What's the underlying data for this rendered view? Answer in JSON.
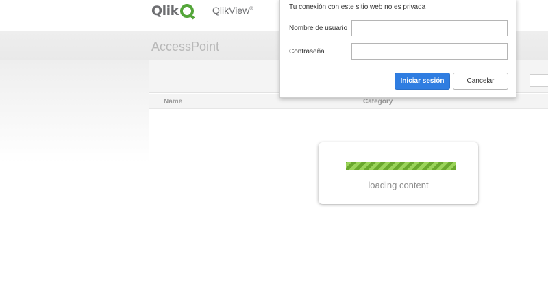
{
  "header": {
    "brand": "Qlik",
    "product": "QlikView",
    "product_mark": "®"
  },
  "page": {
    "title": "AccessPoint"
  },
  "table": {
    "columns": [
      "Name",
      "Category"
    ]
  },
  "loading": {
    "text": "loading content",
    "progress_percent": 100,
    "bar_color": "#7fc241"
  },
  "auth_dialog": {
    "message": "Tu conexión con este sitio web no es privada",
    "username_label": "Nombre de usuario",
    "username_value": "",
    "password_label": "Contraseña",
    "password_value": "",
    "login_button": "Iniciar sesión",
    "cancel_button": "Cancelar",
    "primary_color": "#2f7de1"
  },
  "colors": {
    "qlik_green": "#54a63a",
    "band_gray": "#eeeeee"
  }
}
